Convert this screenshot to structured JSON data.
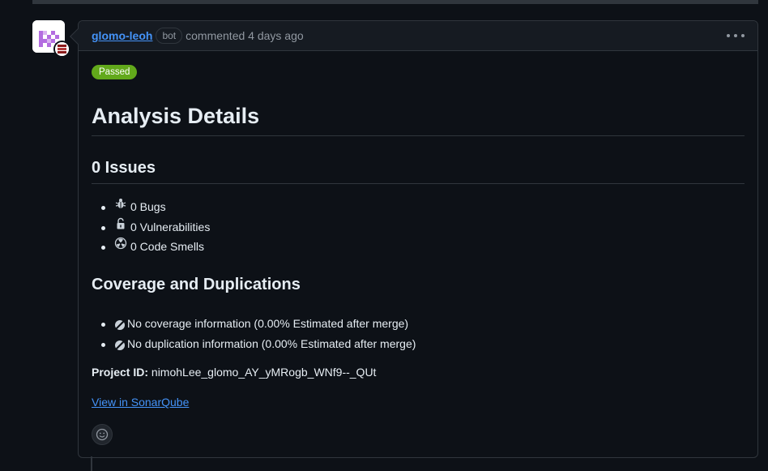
{
  "comment": {
    "author": "glomo-leoh",
    "bot_label": "bot",
    "meta": "commented 4 days ago",
    "menu_icon": "kebab-horizontal-icon"
  },
  "report": {
    "status_badge": "Passed",
    "status_color": "#62a91b",
    "title": "Analysis Details",
    "issues_heading": "0 Issues",
    "issues": [
      {
        "icon": "bug-icon",
        "text": "0 Bugs"
      },
      {
        "icon": "unlock-icon",
        "text": "0 Vulnerabilities"
      },
      {
        "icon": "code-smell-icon",
        "text": "0 Code Smells"
      }
    ],
    "coverage_heading": "Coverage and Duplications",
    "coverage": [
      {
        "icon": "no-data-icon",
        "text": "No coverage information (0.00% Estimated after merge)"
      },
      {
        "icon": "no-data-icon",
        "text": "No duplication information (0.00% Estimated after merge)"
      }
    ],
    "project_label": "Project ID:",
    "project_id": "nimohLee_glomo_AY_yMRogb_WNf9--_QUt",
    "link_text": "View in SonarQube"
  },
  "colors": {
    "background": "#0d1117",
    "header_bg": "#161b22",
    "border": "#30363d",
    "link": "#4493f8",
    "muted": "#9198a1"
  }
}
